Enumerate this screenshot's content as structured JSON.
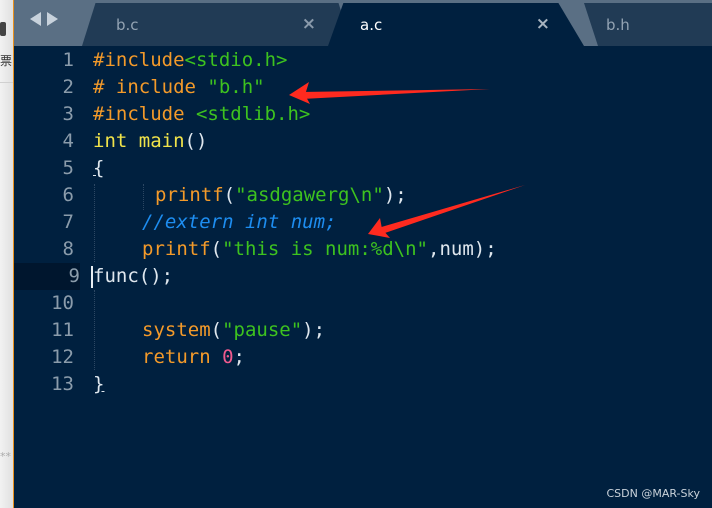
{
  "background_window": {
    "glyph_char": "票",
    "glyph_bottom": "**"
  },
  "tabs": [
    {
      "label": "b.c",
      "active": false,
      "close_icon": "×"
    },
    {
      "label": "a.c",
      "active": true,
      "close_icon": "×"
    },
    {
      "label": "b.h",
      "active": false
    }
  ],
  "editor": {
    "current_line": 9,
    "lines": [
      {
        "number": "1"
      },
      {
        "number": "2"
      },
      {
        "number": "3"
      },
      {
        "number": "4"
      },
      {
        "number": "5"
      },
      {
        "number": "6"
      },
      {
        "number": "7"
      },
      {
        "number": "8"
      },
      {
        "number": "9"
      },
      {
        "number": "10"
      },
      {
        "number": "11"
      },
      {
        "number": "12"
      },
      {
        "number": "13"
      }
    ],
    "code": {
      "l1": {
        "directive": "#include",
        "header": "<stdio.h>"
      },
      "l2": {
        "directive": "# include ",
        "header": "\"b.h\""
      },
      "l3": {
        "directive": "#include ",
        "header": "<stdlib.h>"
      },
      "l4": {
        "type": "int",
        "name": "main",
        "parens": "()"
      },
      "l5": {
        "brace": "{"
      },
      "l6": {
        "fn": "printf",
        "open": "(",
        "string": "\"asdgawerg\\n\"",
        "close": ");"
      },
      "l7": {
        "comment": "//extern int num;"
      },
      "l8": {
        "fn": "printf",
        "open": "(",
        "string": "\"this is num:%d\\n\"",
        "rest": ",num);"
      },
      "l9": {
        "text": "func();"
      },
      "l11": {
        "fn": "system",
        "open": "(",
        "string": "\"pause\"",
        "close": ");"
      },
      "l12": {
        "kw": "return",
        "num": "0",
        "close": ";"
      },
      "l13": {
        "brace": "}"
      }
    }
  },
  "annotations": {
    "arrow_color": "#ff2a1f",
    "arrows": [
      {
        "points_to": "line 2 \"b.h\""
      },
      {
        "points_to": "line 7 //extern int num;"
      }
    ]
  },
  "watermark": "CSDN @MAR-Sky",
  "colors": {
    "editor_bg": "#00203f",
    "tabbar_bg": "#5a6f84",
    "inactive_tab": "#213b55",
    "preprocessor": "#f39a2a",
    "string": "#3dc21f",
    "type": "#f0e34a",
    "comment": "#1d8df0",
    "number": "#f05a8e"
  }
}
